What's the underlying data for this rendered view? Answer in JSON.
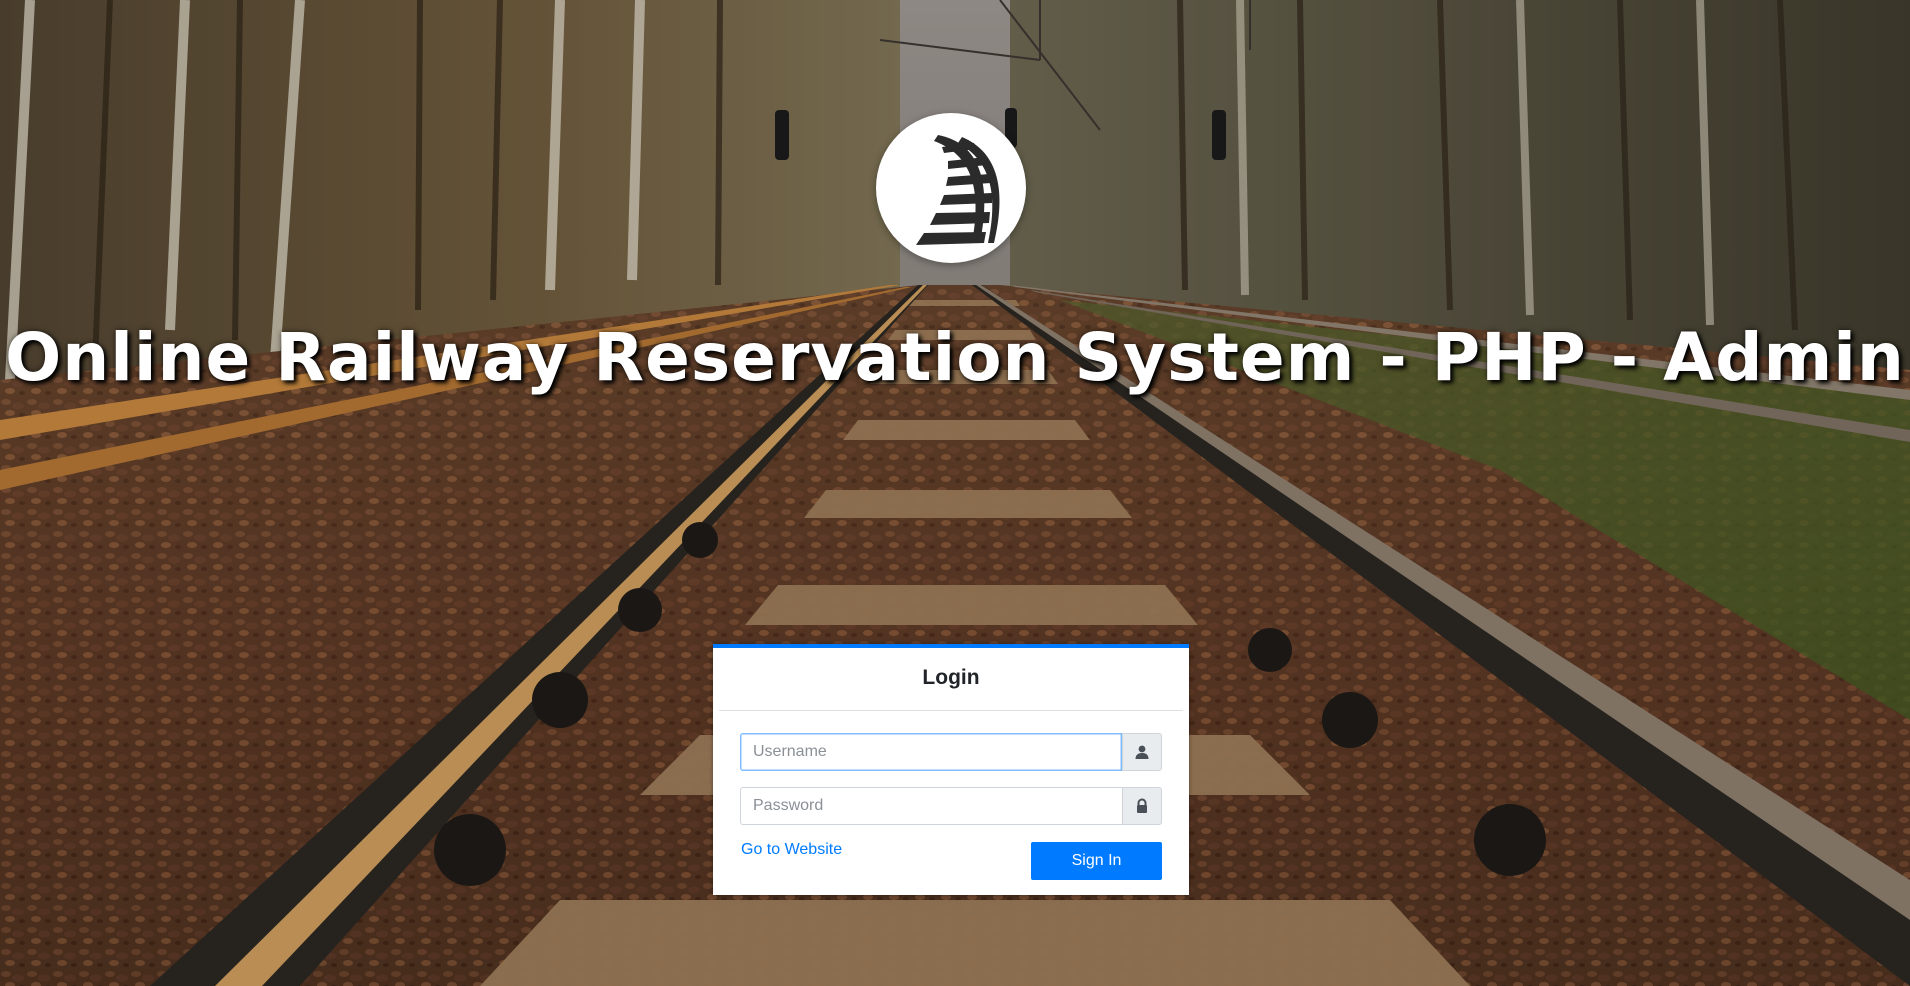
{
  "page": {
    "title": "Online Railway Reservation System - PHP - Admin"
  },
  "logo": {
    "icon": "railway-track-icon"
  },
  "login": {
    "heading": "Login",
    "username": {
      "value": "",
      "placeholder": "Username",
      "icon": "user-icon"
    },
    "password": {
      "value": "",
      "placeholder": "Password",
      "icon": "lock-icon"
    },
    "website_link": "Go to Website",
    "signin_label": "Sign In"
  },
  "colors": {
    "accent": "#007bff",
    "title_text": "#ffffff",
    "card_background": "#ffffff"
  }
}
